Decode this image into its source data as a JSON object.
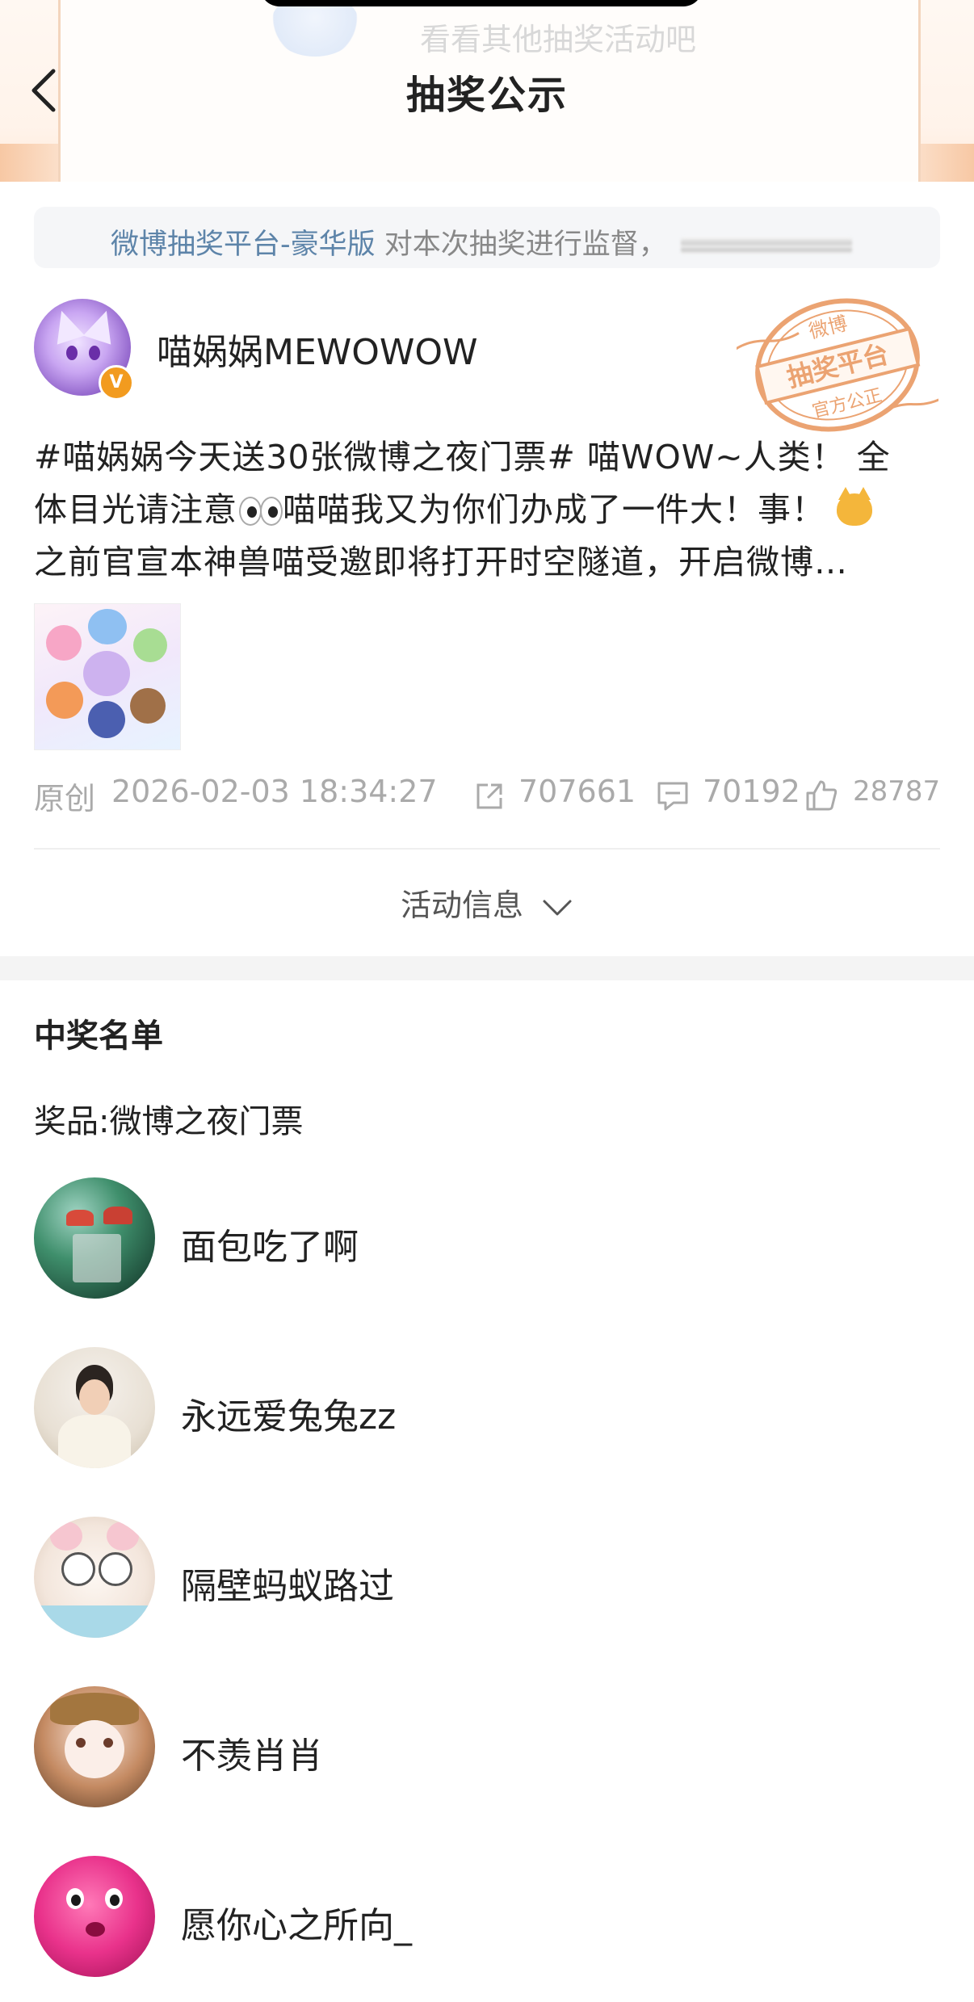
{
  "header": {
    "title": "抽奖公示",
    "background_hint_text": "看看其他抽奖活动吧"
  },
  "supervision": {
    "platform_link": "微博抽奖平台-豪华版",
    "text": "对本次抽奖进行监督，"
  },
  "author": {
    "name": "喵娲娲MEWOWOW",
    "badge": "V"
  },
  "stamp": {
    "top_text": "微博",
    "middle_text": "抽奖平台",
    "bottom_text": "官方公正"
  },
  "post": {
    "line1": "#喵娲娲今天送30张微博之夜门票# 喵WOW~人类！ 全",
    "line2_a": "体目光请注意",
    "line2_b": "喵喵我又为你们办成了一件大！事！",
    "line3": "之前官宣本神兽喵受邀即将打开时空隧道，开启微博…"
  },
  "meta": {
    "type": "原创",
    "time": "2026-02-03 18:34:27",
    "reposts": "707661",
    "comments": "70192",
    "likes": "28787"
  },
  "activity": {
    "label": "活动信息"
  },
  "winners": {
    "title": "中奖名单",
    "prize": "奖品:微博之夜门票",
    "list": [
      {
        "name": "面包吃了啊"
      },
      {
        "name": "永远爱兔兔zz"
      },
      {
        "name": "隔壁蚂蚁路过"
      },
      {
        "name": "不羡肖肖"
      },
      {
        "name": "愿你心之所向_"
      }
    ]
  },
  "colors": {
    "link": "#5d84a9",
    "muted": "#aaaaaa",
    "stamp": "#e8945a",
    "vip_badge": "#f29b1f"
  }
}
